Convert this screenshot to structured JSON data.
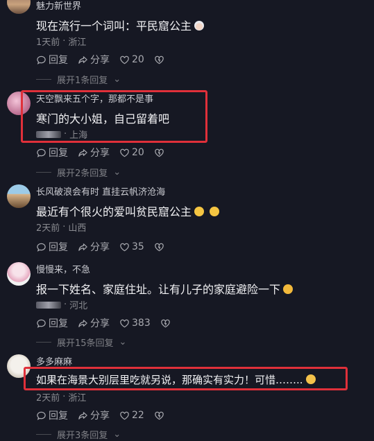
{
  "comments": [
    {
      "username": "魅力新世界",
      "text": "现在流行一个词叫：平民窟公主",
      "time": "1天前",
      "location": "浙江",
      "reply_label": "回复",
      "share_label": "分享",
      "likes": "20",
      "expand_label": "展开1条回复"
    },
    {
      "username": "天空飘来五个字，那都不是事",
      "text": "寒门的大小姐，自己留着吧",
      "time": "",
      "location": "上海",
      "reply_label": "回复",
      "share_label": "分享",
      "likes": "20",
      "expand_label": "展开2条回复"
    },
    {
      "username": "长风破浪会有时 直挂云帆济沧海",
      "text": "最近有个很火的爱叫贫民窟公主",
      "time": "2天前",
      "location": "山西",
      "reply_label": "回复",
      "share_label": "分享",
      "likes": "35",
      "expand_label": ""
    },
    {
      "username": "慢慢来，不急",
      "text": "报一下姓名、家庭住址。让有儿子的家庭避险一下",
      "time": "",
      "location": "河北",
      "reply_label": "回复",
      "share_label": "分享",
      "likes": "383",
      "expand_label": "展开15条回复"
    },
    {
      "username": "多多麻麻",
      "text": "如果在海景大别层里吃就另说，那确实有实力！可惜……..",
      "time": "2天前",
      "location": "浙江",
      "reply_label": "回复",
      "share_label": "分享",
      "likes": "22",
      "expand_label": "展开3条回复"
    }
  ],
  "separator": "·",
  "colors": {
    "background": "#161823",
    "highlight": "#e0303a",
    "meta": "#8a8b91"
  }
}
